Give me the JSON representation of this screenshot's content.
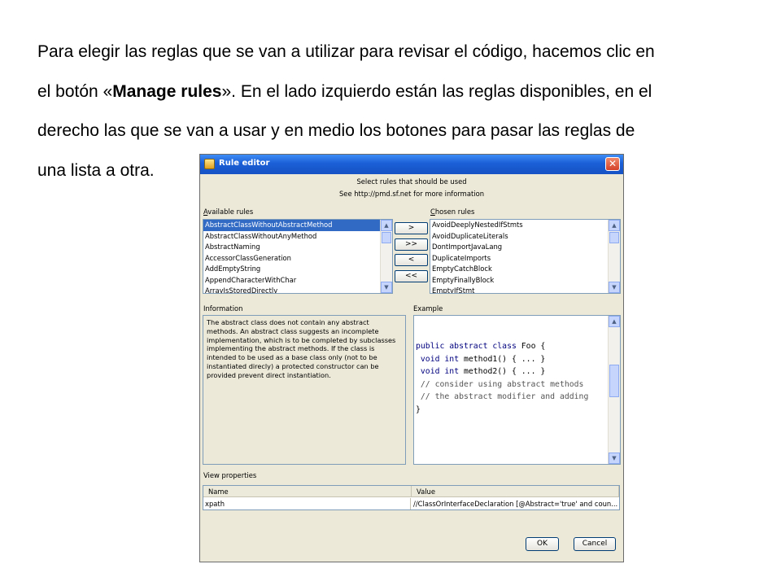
{
  "slide": {
    "line1": "Para elegir las reglas que se van a utilizar para revisar el código, hacemos clic en",
    "line2_before": "el botón «",
    "line2_bold": "Manage rules",
    "line2_after": "».  En el lado izquierdo están las reglas disponibles, en el",
    "line3": "derecho las que se van a usar y en medio los botones para pasar las reglas de",
    "line4": "una lista a otra."
  },
  "dialog": {
    "title": "Rule editor",
    "close_glyph": "✕",
    "header_line1": "Select rules that should be used",
    "header_line2": "See http://pmd.sf.net for more information",
    "available_label_first": "A",
    "available_label_rest": "vailable rules",
    "chosen_label_first": "C",
    "chosen_label_rest": "hosen rules",
    "available_rules": [
      "AbstractClassWithoutAbstractMethod",
      "AbstractClassWithoutAnyMethod",
      "AbstractNaming",
      "AccessorClassGeneration",
      "AddEmptyString",
      "AppendCharacterWithChar",
      "ArrayIsStoredDirectly"
    ],
    "chosen_rules": [
      "AvoidDeeplyNestedIfStmts",
      "AvoidDuplicateLiterals",
      "DontImportJavaLang",
      "DuplicateImports",
      "EmptyCatchBlock",
      "EmptyFinallyBlock",
      "EmptyIfStmt"
    ],
    "buttons": {
      "add": ">",
      "add_all": ">>",
      "remove": "<",
      "remove_all": "<<",
      "ok": "OK",
      "cancel": "Cancel"
    },
    "information_label": "Information",
    "example_label": "Example",
    "information_text": "The abstract class does not contain any abstract methods. An abstract class suggests an incomplete implementation, which is to be completed by subclasses implementing the abstract methods. If the class is intended to be used as a base class only (not to be instantiated direcly) a protected constructor can be provided prevent direct instantiation.",
    "example_code": {
      "l1_kw": "public abstract class",
      "l1_rest": " Foo {",
      "l2_pre": " ",
      "l2_kw": "void int",
      "l2_rest": " method1() { ... }",
      "l3_pre": " ",
      "l3_kw": "void int",
      "l3_rest": " method2() { ... }",
      "l4": " // consider using abstract methods",
      "l5": " // the abstract modifier and adding",
      "l6": "}"
    },
    "properties_label": "View properties",
    "table": {
      "col_name": "Name",
      "col_value": "Value",
      "row_name": "xpath",
      "row_value": "//ClassOrInterfaceDeclaration [@Abstract='true'  and coun..."
    }
  }
}
